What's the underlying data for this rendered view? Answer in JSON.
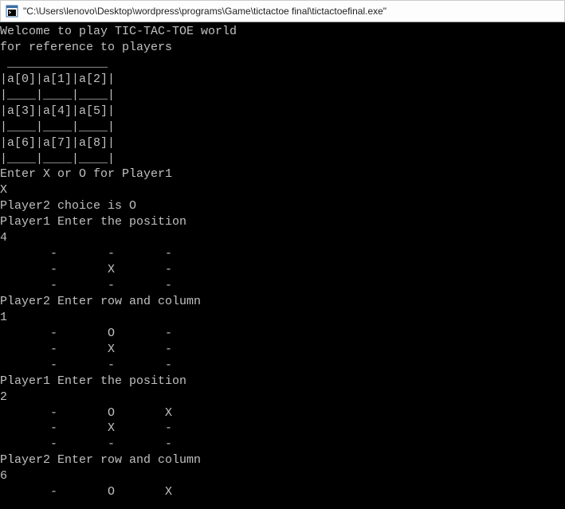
{
  "titlebar": {
    "icon_name": "console-app-icon",
    "path": "\"C:\\Users\\lenovo\\Desktop\\wordpress\\programs\\Game\\tictactoe final\\tictactoefinal.exe\""
  },
  "console": {
    "lines": [
      "Welcome to play TIC-TAC-TOE world",
      "for reference to players",
      " ______________",
      "|a[0]|a[1]|a[2]|",
      "|____|____|____|",
      "|a[3]|a[4]|a[5]|",
      "|____|____|____|",
      "|a[6]|a[7]|a[8]|",
      "|____|____|____|",
      "Enter X or O for Player1",
      "X",
      "Player2 choice is O",
      "Player1 Enter the position",
      "4",
      "       -       -       -",
      "       -       X       -",
      "       -       -       -",
      "Player2 Enter row and column",
      "1",
      "       -       O       -",
      "       -       X       -",
      "       -       -       -",
      "Player1 Enter the position",
      "2",
      "       -       O       X",
      "       -       X       -",
      "       -       -       -",
      "Player2 Enter row and column",
      "6",
      "       -       O       X"
    ]
  }
}
